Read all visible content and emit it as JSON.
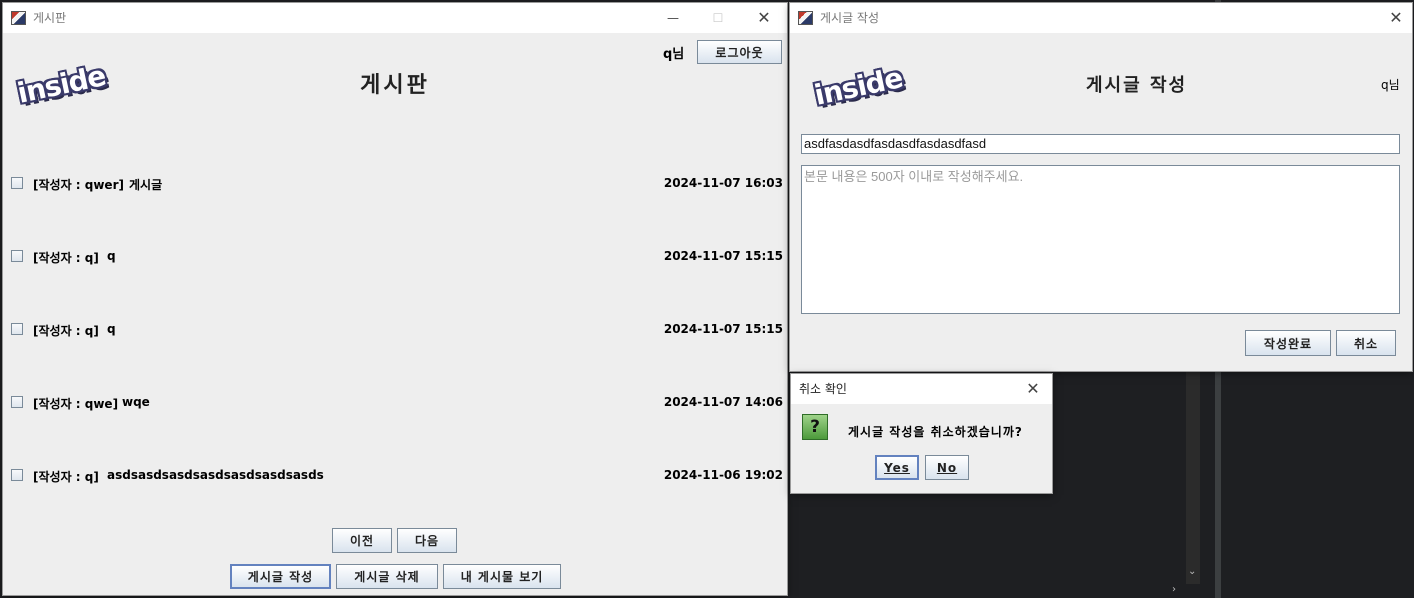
{
  "board_window": {
    "title": "게시판",
    "user_label": "q님",
    "logout_button": "로그아웃",
    "logo_text": "inside",
    "heading": "게시판",
    "posts": [
      {
        "author": "[작성자 : qwer]",
        "title": "게시글",
        "date": "2024-11-07 16:03"
      },
      {
        "author": "[작성자 : q]",
        "title": "q",
        "date": "2024-11-07 15:15"
      },
      {
        "author": "[작성자 : q]",
        "title": "q",
        "date": "2024-11-07 15:15"
      },
      {
        "author": "[작성자 : qwe]",
        "title": "wqe",
        "date": "2024-11-07 14:06"
      },
      {
        "author": "[작성자 : q]",
        "title": "asdsasdsasdsasdsasdsasdsasds",
        "date": "2024-11-06 19:02"
      }
    ],
    "prev_button": "이전",
    "next_button": "다음",
    "write_button": "게시글 작성",
    "delete_button": "게시글 삭제",
    "my_posts_button": "내 게시물 보기",
    "window_controls": {
      "minimize": "—",
      "maximize": "☐",
      "close": "✕"
    }
  },
  "write_window": {
    "title": "게시글 작성",
    "logo_text": "inside",
    "heading": "게시글 작성",
    "user_label": "q님",
    "title_field_value": "asdfasdasdfasdasdfasdasdfasd",
    "body_placeholder": "본문 내용은 500자 이내로 작성해주세요.",
    "submit_button": "작성완료",
    "cancel_button": "취소",
    "close": "✕"
  },
  "confirm_dialog": {
    "title": "취소 확인",
    "message": "게시글 작성을 취소하겠습니까?",
    "icon_glyph": "?",
    "yes_button": "Yes",
    "no_button": "No",
    "close": "✕"
  },
  "colors": {
    "window_bg": "#eeeeee",
    "title_bar": "#ffffff",
    "button_border": "#7a8a99",
    "focus_border": "#6382bf"
  }
}
